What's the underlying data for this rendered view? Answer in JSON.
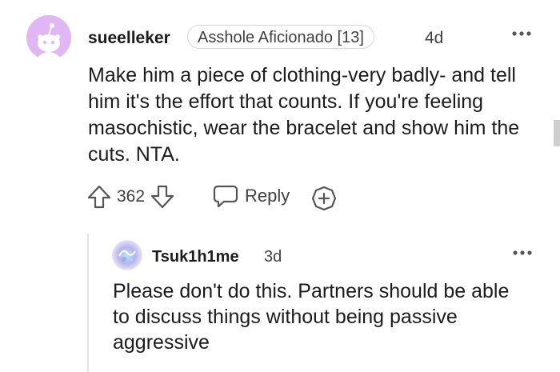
{
  "comment": {
    "username": "sueelleker",
    "flair": "Asshole Aficionado [13]",
    "age": "4d",
    "body": "Make him a piece of clothing-very badly- and tell him it's the effort that counts. If you're feeling masochistic, wear the bracelet and show him the cuts. NTA.",
    "votes": "362",
    "reply_label": "Reply",
    "avatar_color": "#e0b7f5"
  },
  "reply": {
    "username": "Tsuk1h1me",
    "age": "3d",
    "body": "Please don't do this. Partners should be able to discuss things without being passive aggressive"
  },
  "icons": [
    "snoo-avatar-icon",
    "more-options-icon",
    "upvote-icon",
    "downvote-icon",
    "reply-icon",
    "award-icon"
  ]
}
